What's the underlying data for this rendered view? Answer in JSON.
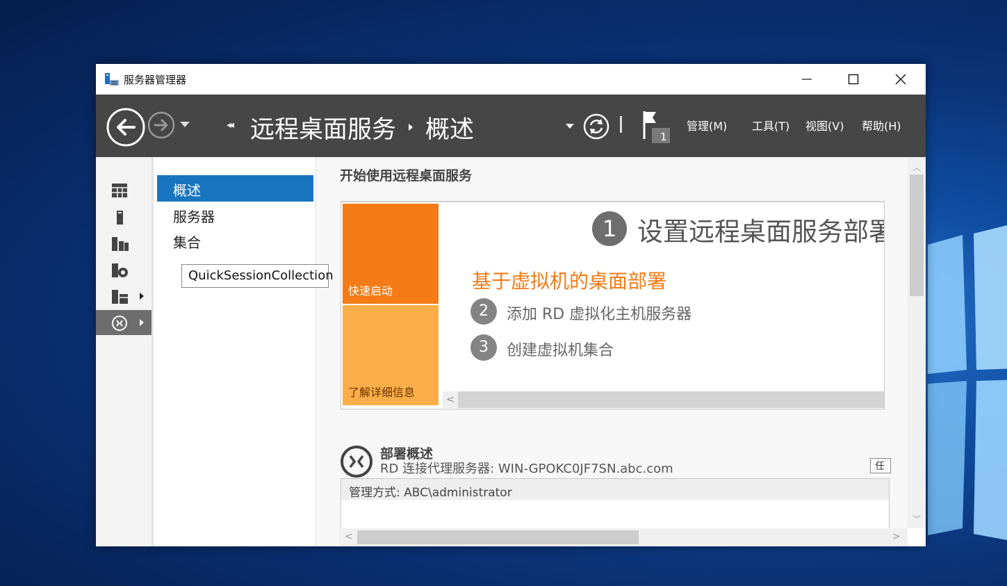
{
  "window": {
    "title": "服务器管理器",
    "controls": {
      "minimize": "minimize",
      "maximize": "maximize",
      "close": "close"
    }
  },
  "navbar": {
    "breadcrumb": [
      "远程桌面服务",
      "概述"
    ],
    "notification_count": "1",
    "menus": [
      "管理(M)",
      "工具(T)",
      "视图(V)",
      "帮助(H)"
    ]
  },
  "left_nav": {
    "icons": [
      "dashboard-icon",
      "local-server-icon",
      "all-servers-icon",
      "file-storage-icon",
      "server-roles-icon",
      "remote-desktop-icon"
    ],
    "active_index": 5
  },
  "sub_nav": {
    "items": [
      "概述",
      "服务器",
      "集合"
    ],
    "selected": "概述",
    "tooltip": "QuickSessionCollection"
  },
  "content": {
    "heading": "开始使用远程桌面服务",
    "tiles": {
      "quick_start": "快速启动",
      "learn_more": "了解详细信息"
    },
    "step1": {
      "number": "1",
      "label": "设置远程桌面服务部署"
    },
    "deployment_title": "基于虚拟机的桌面部署",
    "step2": {
      "number": "2",
      "label": "添加 RD 虚拟化主机服务器"
    },
    "step3": {
      "number": "3",
      "label": "创建虚拟机集合"
    },
    "deployment_overview": {
      "title": "部署概述",
      "broker": "RD 连接代理服务器: WIN-GPOKC0JF7SN.abc.com",
      "button_fragment": "任",
      "managed_by": "管理方式: ABC\\administrator"
    }
  },
  "colors": {
    "accent_blue": "#1a75c0",
    "tile_orange": "#f47b16",
    "tile_light_orange": "#fbae49",
    "navbar": "#464646"
  }
}
